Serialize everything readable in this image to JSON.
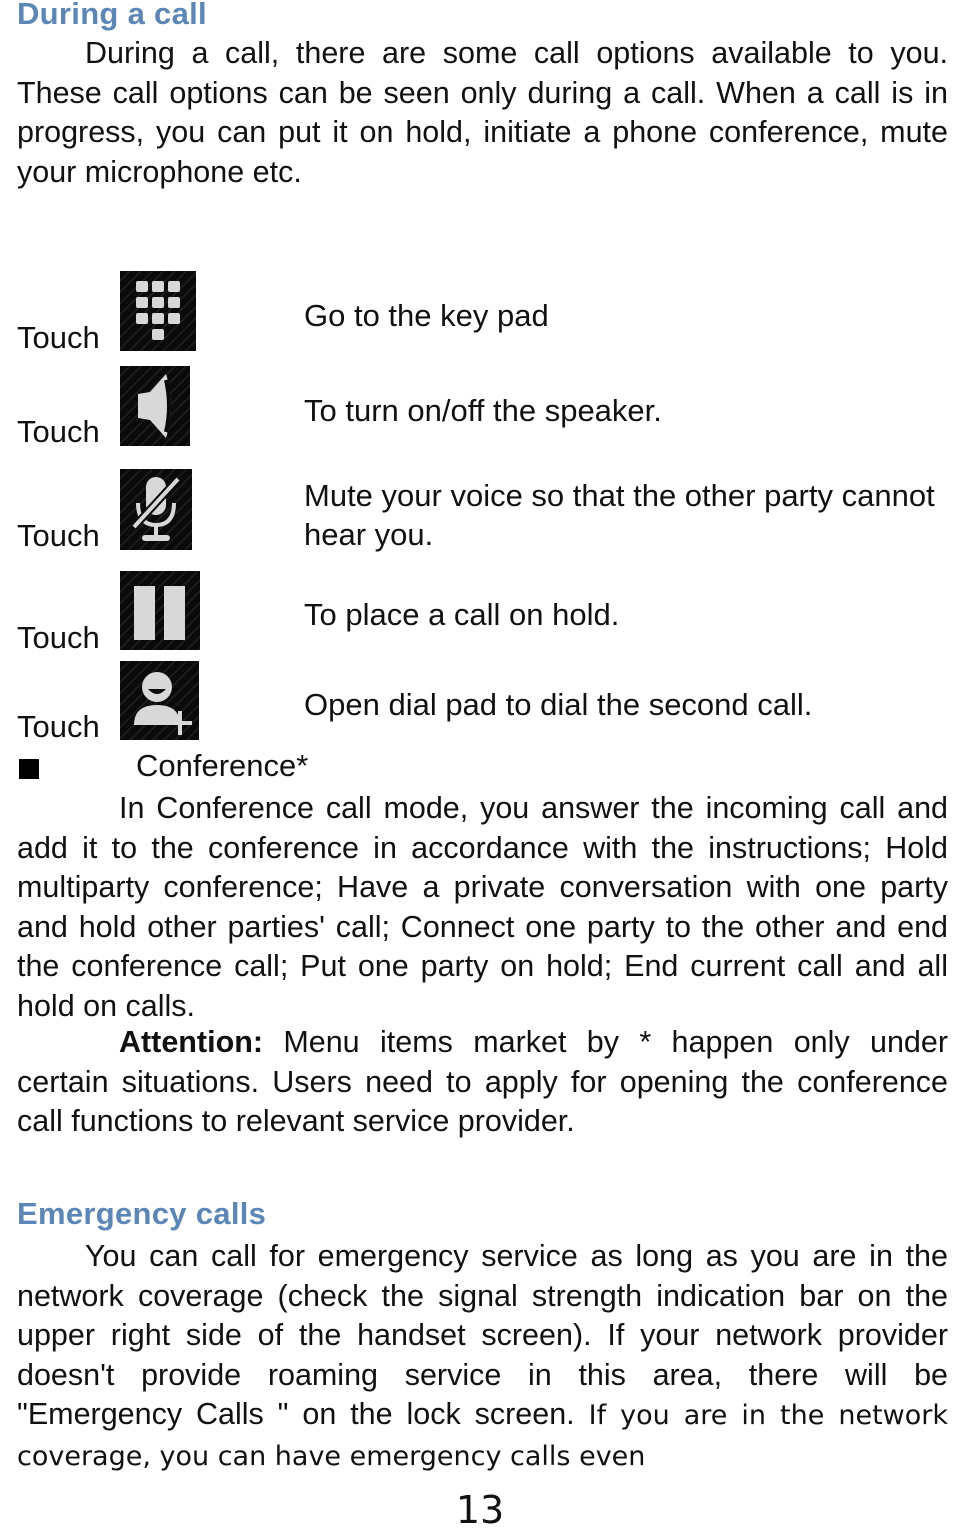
{
  "sections": {
    "during_call": {
      "heading": "During a call",
      "intro": "During a call, there are some call options available to you. These call options can be seen only during a call. When a call is in progress, you can put it on hold, initiate a phone conference, mute your microphone etc."
    },
    "call_options": [
      {
        "touch_label": "Touch",
        "icon": "keypad-icon",
        "description": "Go to the key pad"
      },
      {
        "touch_label": "Touch",
        "icon": "speaker-icon",
        "description": "To turn on/off the speaker."
      },
      {
        "touch_label": "Touch",
        "icon": "mute-microphone-icon",
        "description": "Mute your voice so that the other party cannot hear you."
      },
      {
        "touch_label": "Touch",
        "icon": "hold-pause-icon",
        "description": "To place a call on hold."
      },
      {
        "touch_label": "Touch",
        "icon": "add-call-icon",
        "description": "Open dial pad to dial the second call."
      }
    ],
    "conference": {
      "title": "Conference*",
      "body": "In Conference call mode, you answer the incoming call and add it to the conference in accordance with the instructions; Hold multiparty conference; Have a private conversation with one party and hold other parties' call; Connect one party to the other and end the conference call; Put one party on hold; End current call and all hold on calls.",
      "attention_label": "Attention:",
      "attention_body": " Menu items market by * happen only under certain situations. Users need to apply for opening the conference call functions to relevant service provider."
    },
    "emergency": {
      "heading": "Emergency calls",
      "body": "You can call for emergency service as long as you are in the network coverage (check the signal strength indication bar on the upper right side of the handset screen). If your network provider doesn't provide roaming service in this area, there will be \"Emergency Calls \" on the lock screen.",
      "body_tail": " If you are in the network coverage, you can have emergency calls even"
    }
  },
  "page_number": "13",
  "colors": {
    "heading": "#5b86b8",
    "text": "#111111",
    "icon_bg": "#0a0a0a",
    "icon_fg": "#d8d8d8"
  }
}
